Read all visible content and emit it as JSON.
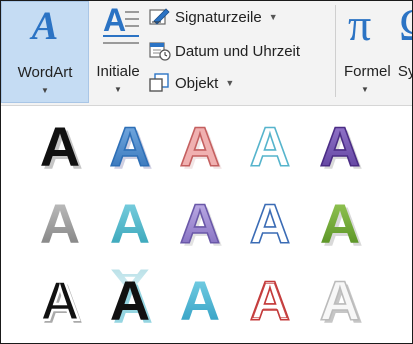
{
  "ribbon": {
    "wordart": {
      "label": "WordArt",
      "icon": "wordart-icon"
    },
    "initiale": {
      "label": "Initiale",
      "icon": "drop-cap-icon"
    },
    "signaturzeile": {
      "label": "Signaturzeile",
      "icon": "signature-line-icon"
    },
    "datum_uhrzeit": {
      "label": "Datum und Uhrzeit",
      "icon": "date-time-icon"
    },
    "objekt": {
      "label": "Objekt",
      "icon": "object-icon"
    },
    "formel": {
      "label": "Formel",
      "icon": "pi-icon"
    },
    "symbol_partial": {
      "label": "Sy",
      "icon": "symbol-icon"
    }
  },
  "gallery": {
    "glyph": "A",
    "styles": [
      [
        "black-fill-shadow",
        "blue-gradient",
        "pink-fill-outline",
        "white-outline-teal-glow",
        "purple-bevel"
      ],
      [
        "gray-gradient",
        "teal-reflection",
        "lavender-bevel",
        "white-blue-outline",
        "green-gradient"
      ],
      [
        "black-white-outline-shadow",
        "black-teal-offset",
        "teal-gradient",
        "white-red-outline",
        "white-gray-shadow"
      ]
    ]
  },
  "colors": {
    "accent": "#2b73c4",
    "selected_bg": "#c5dcf3",
    "ribbon_bg": "#f3f3f3"
  }
}
